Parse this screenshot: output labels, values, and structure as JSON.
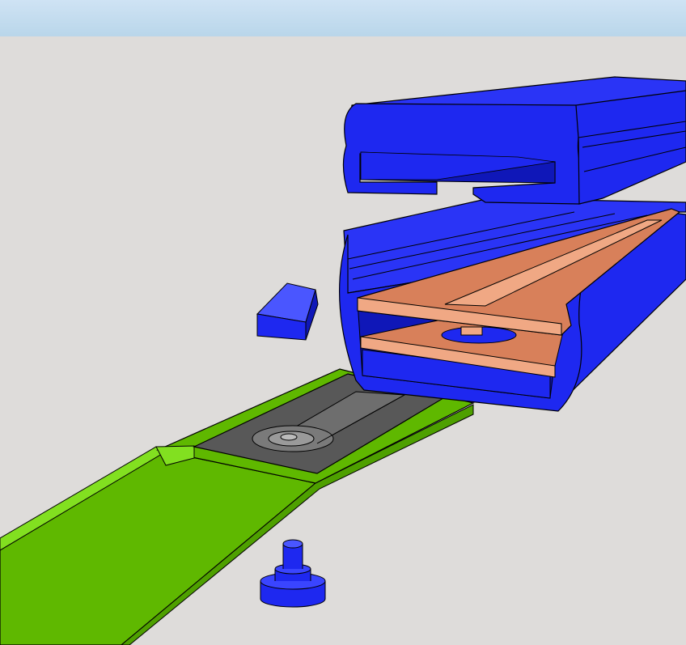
{
  "colors": {
    "sky": "#c6def0",
    "ground": "#dedcda",
    "housing_blue": "#1e28f0",
    "housing_blue_dark": "#0f17b8",
    "housing_blue_light": "#4a56ff",
    "base_green": "#5fb800",
    "base_green_light": "#82e020",
    "base_green_dark": "#3f8a00",
    "copper": "#d8805a",
    "copper_light": "#f0a884",
    "plate_dark": "#555555",
    "plate_mid": "#6a6a6a"
  },
  "parts": {
    "top_cap": "blue-top-cap",
    "housing": "blue-housing-body",
    "end_block": "blue-end-block",
    "copper_plate_upper": "copper-plate-upper",
    "copper_plate_lower": "copper-plate-lower",
    "green_base": "green-base-rail",
    "metal_plate": "dark-metal-plate",
    "thumb_screw": "blue-thumb-screw"
  }
}
